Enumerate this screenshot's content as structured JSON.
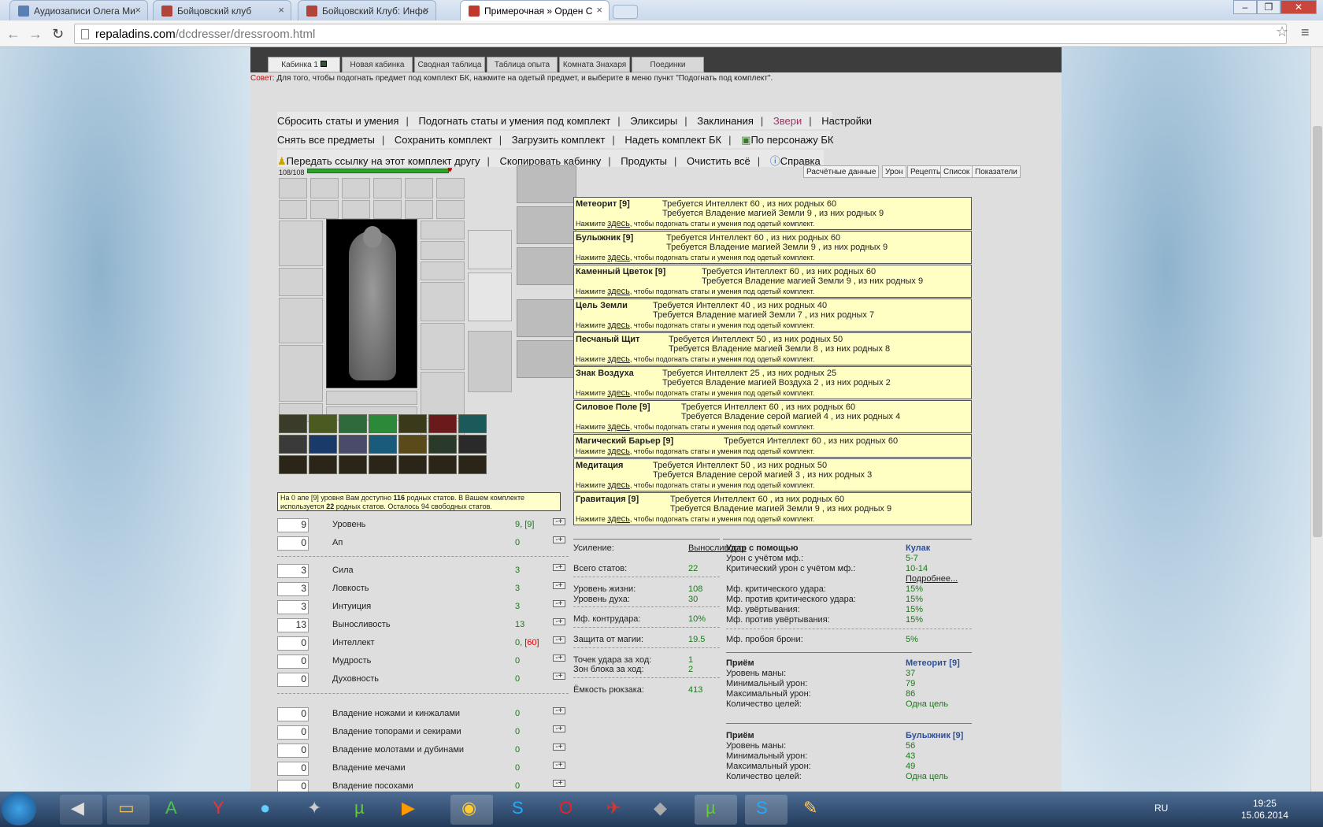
{
  "browser": {
    "tabs": [
      {
        "label": "Аудиозаписи Олега Ми",
        "color": "#5a7fb5"
      },
      {
        "label": "Бойцовский клуб",
        "color": "#b0443a"
      },
      {
        "label": "Бойцовский Клуб: Инфо",
        "color": "#b0443a"
      },
      {
        "label": "Примерочная » Орден С",
        "color": "#c0392b"
      }
    ],
    "url_domain": "repaladins.com",
    "url_path": "/dcdresser/dressroom.html",
    "win_min": "–",
    "win_max": "❐",
    "win_close": "✕",
    "back": "←",
    "forward": "→",
    "reload": "↻",
    "star": "☆",
    "menu": "≡",
    "tab_close": "×"
  },
  "page_tabs": [
    "Кабинка 1",
    "Новая кабинка",
    "Сводная таблица",
    "Таблица опыта",
    "Комната Знахаря",
    "Поединки"
  ],
  "advice": {
    "prefix": "Совет:",
    "text": " Для того, чтобы подогнать предмет под комплект БК, нажмите на одетый предмет, и выберите в меню пункт \"Подогнать под комплект\"."
  },
  "menu": {
    "row1": [
      "Сбросить статы и умения",
      "Подогнать статы и умения под комплект",
      "Эликсиры",
      "Заклинания",
      "Звери",
      "Настройки"
    ],
    "row2": [
      "Снять все предметы",
      "Сохранить комплект",
      "Загрузить комплект",
      "Надеть комплект БК",
      "По персонажу БК"
    ],
    "row3": [
      "Передать ссылку на этот комплект другу",
      "Скопировать кабинку",
      "Продукты",
      "Очистить всё",
      "Справка"
    ]
  },
  "hp": "108/108",
  "info_box": {
    "pre": "На 0 апе [9] уровня Вам доступно ",
    "available": "116",
    "mid": " родных статов. В Вашем комплекте используется ",
    "used": "22",
    "post": " родных статов. Осталось 94 свободных статов."
  },
  "stats": [
    {
      "input": "9",
      "label": "Уровень",
      "val": "9, [9]",
      "extra": ""
    },
    {
      "input": "0",
      "label": "Ап",
      "val": "0",
      "extra": ""
    },
    {
      "input": "3",
      "label": "Сила",
      "val": "3",
      "extra": ""
    },
    {
      "input": "3",
      "label": "Ловкость",
      "val": "3",
      "extra": ""
    },
    {
      "input": "3",
      "label": "Интуиция",
      "val": "3",
      "extra": ""
    },
    {
      "input": "13",
      "label": "Выносливость",
      "val": "13",
      "extra": ""
    },
    {
      "input": "0",
      "label": "Интеллект",
      "val": "0, ",
      "extra": "[60]"
    },
    {
      "input": "0",
      "label": "Мудрость",
      "val": "0",
      "extra": ""
    },
    {
      "input": "0",
      "label": "Духовность",
      "val": "0",
      "extra": ""
    },
    {
      "input": "0",
      "label": "Владение ножами и кинжалами",
      "val": "0",
      "extra": ""
    },
    {
      "input": "0",
      "label": "Владение топорами и секирами",
      "val": "0",
      "extra": ""
    },
    {
      "input": "0",
      "label": "Владение молотами и дубинами",
      "val": "0",
      "extra": ""
    },
    {
      "input": "0",
      "label": "Владение мечами",
      "val": "0",
      "extra": ""
    },
    {
      "input": "0",
      "label": "Владение посохами",
      "val": "0",
      "extra": ""
    }
  ],
  "pm_label": "-+",
  "right_tabs": [
    "Расчётные данные",
    "Урон",
    "Рецепты",
    "Список",
    "Показатели"
  ],
  "spell_hint_pre": "Нажмите ",
  "spell_hint_link": "здесь",
  "spell_hint_post": ", чтобы подогнать статы и умения под одетый комплект.",
  "spells": [
    {
      "name": "Метеорит [9]",
      "req1": "Требуется Интеллект 60 , из них родных 60",
      "req2": "Требуется Владение магией Земли 9 , из них родных 9"
    },
    {
      "name": "Булыжник [9]",
      "req1": "Требуется Интеллект 60 , из них родных 60",
      "req2": "Требуется Владение магией Земли 9 , из них родных 9"
    },
    {
      "name": "Каменный Цветок [9]",
      "req1": "Требуется Интеллект 60 , из них родных 60",
      "req2": "Требуется Владение магией Земли 9 , из них родных 9"
    },
    {
      "name": "Цель Земли",
      "req1": "Требуется Интеллект 40 , из них родных 40",
      "req2": "Требуется Владение магией Земли 7 , из них родных 7"
    },
    {
      "name": "Песчаный Щит",
      "req1": "Требуется Интеллект 50 , из них родных 50",
      "req2": "Требуется Владение магией Земли 8 , из них родных 8"
    },
    {
      "name": "Знак Воздуха",
      "req1": "Требуется Интеллект 25 , из них родных 25",
      "req2": "Требуется Владение магией Воздуха 2 , из них родных 2"
    },
    {
      "name": "Силовое Поле [9]",
      "req1": "Требуется Интеллект 60 , из них родных 60",
      "req2": "Требуется Владение серой магией 4 , из них родных 4"
    },
    {
      "name": "Магический Барьер [9]",
      "req1": "Требуется Интеллект 60 , из них родных 60",
      "req2": ""
    },
    {
      "name": "Медитация",
      "req1": "Требуется Интеллект 50 , из них родных 50",
      "req2": "Требуется Владение серой магией 3 , из них родных 3"
    },
    {
      "name": "Гравитация [9]",
      "req1": "Требуется Интеллект 60 , из них родных 60",
      "req2": "Требуется Владение магией Земли 9 , из них родных 9"
    }
  ],
  "calc_left": {
    "boost_label": "Усиление:",
    "boost_val": "Выносливость",
    "total_label": "Всего статов:",
    "total_val": "22",
    "life_label": "Уровень жизни:",
    "life_val": "108",
    "spirit_label": "Уровень духа:",
    "spirit_val": "30",
    "counter_label": "Мф. контрудара:",
    "counter_val": "10%",
    "magic_def_label": "Защита от магии:",
    "magic_def_val": "19.5",
    "hits_label": "Точек удара за ход:",
    "hits_val": "1",
    "blocks_label": "Зон блока за ход:",
    "blocks_val": "2",
    "backpack_label": "Ёмкость рюкзака:",
    "backpack_val": "413"
  },
  "calc_right": {
    "strike_label": "Удар с помощью",
    "strike_val": "Кулак",
    "dmg_label": "Урон с учётом мф.:",
    "dmg_val": "5-7",
    "crit_dmg_label": "Критический урон с учётом мф.:",
    "crit_dmg_val": "10-14",
    "more": "Подробнее...",
    "mf_crit_label": "Мф. критического удара:",
    "mf_crit_val": "15%",
    "mf_anticrit_label": "Мф. против критического удара:",
    "mf_anticrit_val": "15%",
    "mf_dodge_label": "Мф. увёртывания:",
    "mf_dodge_val": "15%",
    "mf_antidodge_label": "Мф. против увёртывания:",
    "mf_antidodge_val": "15%",
    "mf_armor_label": "Мф. пробоя брони:",
    "mf_armor_val": "5%",
    "spell1": {
      "title": "Приём",
      "name": "Метеорит [9]",
      "mana_label": "Уровень маны:",
      "mana": "37",
      "min_label": "Минимальный урон:",
      "min": "79",
      "max_label": "Максимальный урон:",
      "max": "86",
      "targets_label": "Количество целей:",
      "targets": "Одна цель"
    },
    "spell2": {
      "title": "Приём",
      "name": "Булыжник [9]",
      "mana_label": "Уровень маны:",
      "mana": "56",
      "min_label": "Минимальный урон:",
      "min": "43",
      "max_label": "Максимальный урон:",
      "max": "49",
      "targets_label": "Количество целей:",
      "targets": "Одна цель"
    }
  },
  "taskbar": {
    "lang": "RU",
    "time": "19:25",
    "date": "15.06.2014",
    "icons": [
      "windows-start-icon",
      "speaker-icon",
      "folder-icon",
      "a-app-icon",
      "yandex-icon",
      "bird-icon",
      "counterstrike-icon",
      "utorrent-icon",
      "media-player-icon",
      "chrome-icon",
      "skype-icon",
      "opera-icon",
      "plane-game-icon",
      "tanks-icon",
      "utorrent-icon-2",
      "skype-icon-2",
      "paint-icon"
    ]
  }
}
